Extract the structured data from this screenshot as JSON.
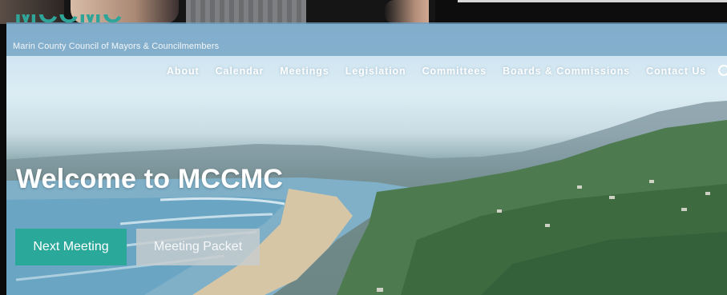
{
  "site": {
    "logo": "MCCMC",
    "tagline": "Marin County Council of Mayors & Councilmembers"
  },
  "nav": {
    "items": [
      "About",
      "Calendar",
      "Meetings",
      "Legislation",
      "Committees",
      "Boards & Commissions",
      "Contact Us"
    ]
  },
  "hero": {
    "heading": "Welcome to MCCMC",
    "next_meeting_label": "Next Meeting",
    "meeting_packet_label": "Meeting Packet"
  },
  "colors": {
    "accent": "#2aa89a",
    "brand_band": "#6ea0c3"
  },
  "icons": {
    "search": "search-icon"
  }
}
